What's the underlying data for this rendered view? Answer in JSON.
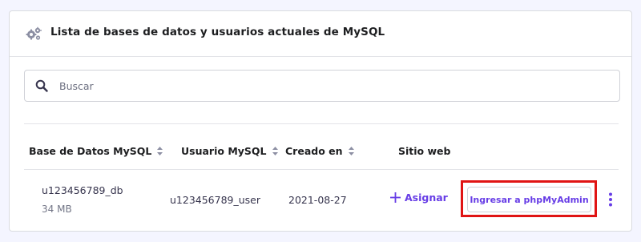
{
  "card": {
    "title": "Lista de bases de datos y usuarios actuales de MySQL",
    "icon": "gears-icon"
  },
  "search": {
    "placeholder": "Buscar",
    "value": ""
  },
  "table": {
    "columns": [
      {
        "label": "Base de Datos MySQL",
        "sortable": true
      },
      {
        "label": "Usuario MySQL",
        "sortable": true
      },
      {
        "label": "Creado en",
        "sortable": true
      },
      {
        "label": "Sitio web",
        "sortable": false
      }
    ],
    "rows": [
      {
        "database": "u123456789_db",
        "size": "34 MB",
        "user": "u123456789_user",
        "created": "2021-08-27",
        "website_action": "Asignar",
        "button_label": "Ingresar a phpMyAdmin"
      }
    ]
  },
  "colors": {
    "accent": "#673de6",
    "highlight_outline": "#e01414",
    "page_background": "#f4f5ff"
  }
}
